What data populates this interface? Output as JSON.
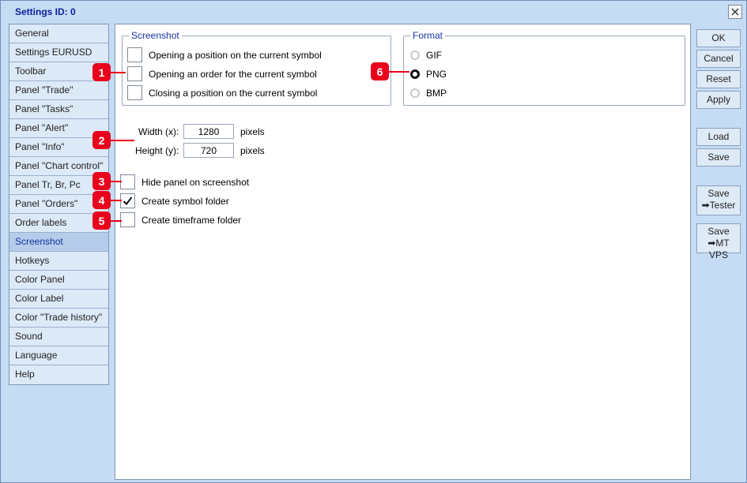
{
  "window": {
    "title": "Settings   ID: 0"
  },
  "sidebar": {
    "items": [
      {
        "label": "General"
      },
      {
        "label": "Settings EURUSD"
      },
      {
        "label": "Toolbar"
      },
      {
        "label": "Panel \"Trade\""
      },
      {
        "label": "Panel \"Tasks\""
      },
      {
        "label": "Panel \"Alert\""
      },
      {
        "label": "Panel \"Info\""
      },
      {
        "label": "Panel \"Chart control\""
      },
      {
        "label": "Panel Tr, Br, Pc"
      },
      {
        "label": "Panel \"Orders\""
      },
      {
        "label": "Order labels"
      },
      {
        "label": "Screenshot"
      },
      {
        "label": "Hotkeys"
      },
      {
        "label": "Color Panel"
      },
      {
        "label": "Color Label"
      },
      {
        "label": "Color \"Trade history\""
      },
      {
        "label": "Sound"
      },
      {
        "label": "Language"
      },
      {
        "label": "Help"
      }
    ],
    "active": "Screenshot"
  },
  "screenshot_group": {
    "title": "Screenshot",
    "options": [
      {
        "label": "Opening a position on the current symbol",
        "checked": false
      },
      {
        "label": "Opening an order for the current symbol",
        "checked": false
      },
      {
        "label": "Closing a position on the current symbol",
        "checked": false
      }
    ]
  },
  "format_group": {
    "title": "Format",
    "options": [
      {
        "label": "GIF",
        "selected": false
      },
      {
        "label": "PNG",
        "selected": true
      },
      {
        "label": "BMP",
        "selected": false
      }
    ]
  },
  "size": {
    "width_label": "Width (x):",
    "width_value": "1280",
    "width_unit": "pixels",
    "height_label": "Height (y):",
    "height_value": "720",
    "height_unit": "pixels"
  },
  "options": {
    "hide_panel": {
      "label": "Hide panel on screenshot",
      "checked": false
    },
    "symbol_folder": {
      "label": "Create symbol folder",
      "checked": true
    },
    "timeframe_folder": {
      "label": "Create timeframe folder",
      "checked": false
    }
  },
  "buttons": {
    "ok": "OK",
    "cancel": "Cancel",
    "reset": "Reset",
    "apply": "Apply",
    "load": "Load",
    "save": "Save",
    "save_tester_1": "Save",
    "save_tester_2": "➡Tester",
    "save_vps_1": "Save",
    "save_vps_2": "➡MT VPS"
  },
  "callouts": [
    "1",
    "2",
    "3",
    "4",
    "5",
    "6"
  ],
  "colors": {
    "callout": "#e8001c",
    "accent": "#1a31a8",
    "background": "#c6dcf4"
  }
}
